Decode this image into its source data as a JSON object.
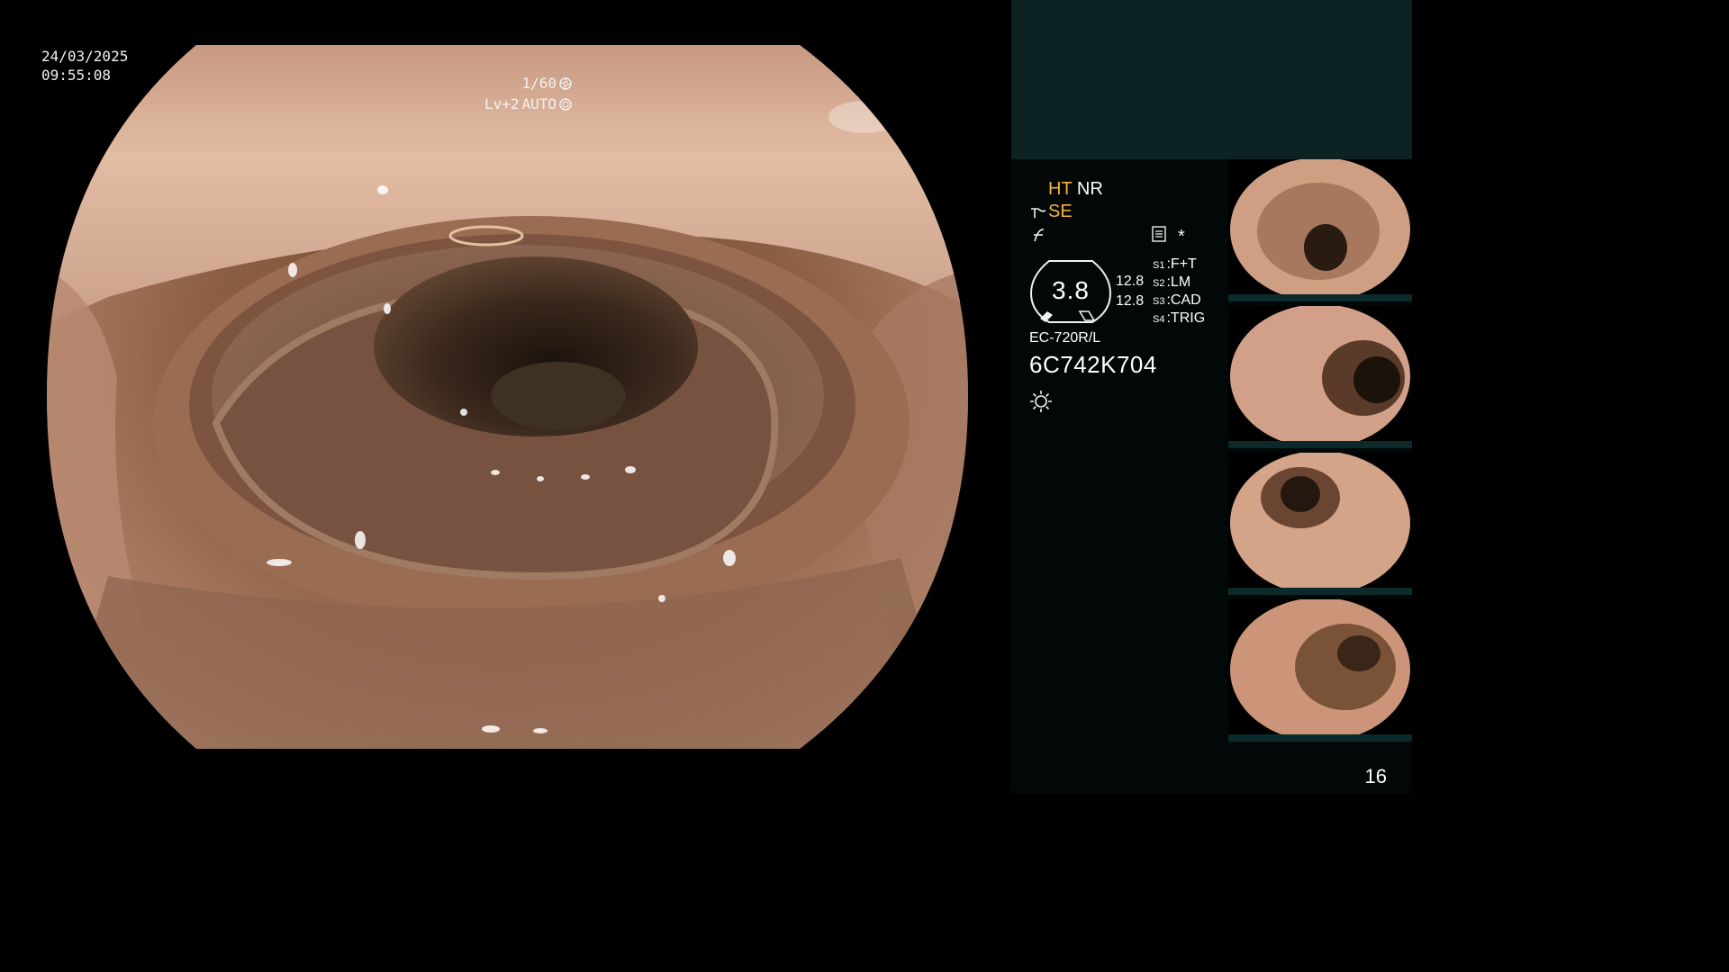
{
  "overlay": {
    "date": "24/03/2025",
    "time": "09:55:08",
    "shutter": "1/60",
    "level": "Lv+2",
    "iris_mode": "AUTO"
  },
  "side_panel": {
    "modes": {
      "ht": "HT",
      "nr": "NR",
      "se": "SE"
    },
    "gauge_value": "3.8",
    "gauge_readings": [
      "12.8",
      "12.8"
    ],
    "switches": [
      {
        "key": "S1",
        "label": "F+T"
      },
      {
        "key": "S2",
        "label": "LM"
      },
      {
        "key": "S3",
        "label": "CAD"
      },
      {
        "key": "S4",
        "label": "TRIG"
      }
    ],
    "marker": "*",
    "scope_model": "EC-720R/L",
    "scope_serial": "6C742K704",
    "thumbnail_count": 4,
    "page_number": "16"
  },
  "colors": {
    "panel_top": "#0d2223",
    "panel_body": "#020808",
    "highlight": "#f5b33a",
    "text": "#f2f2f2"
  },
  "icons": [
    "shutter-icon",
    "iris-icon",
    "structure-enhance-icon",
    "color-enhance-icon",
    "memory-card-icon",
    "light-source-icon"
  ]
}
